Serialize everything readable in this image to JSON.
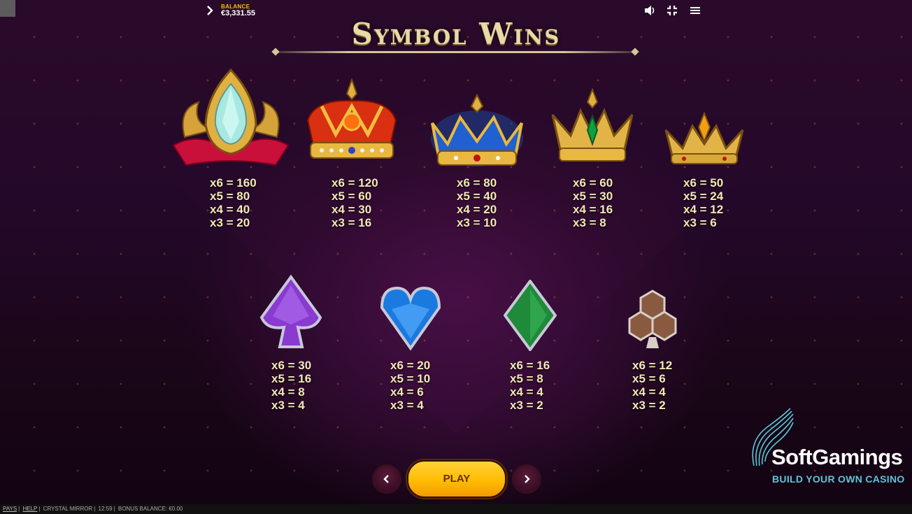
{
  "top_bar": {
    "balance_label": "BALANCE",
    "balance_value": "€3,331.55",
    "icons": [
      "chevron-right-icon",
      "sound-icon",
      "fullscreen-exit-icon",
      "menu-icon"
    ]
  },
  "title": "Symbol Wins",
  "high_symbols": [
    {
      "icon": "jeweled-tiara-icon",
      "pays": [
        "x6 = 160",
        "x5 = 80",
        "x4 = 40",
        "x3 = 20"
      ]
    },
    {
      "icon": "red-crown-icon",
      "pays": [
        "x6 = 120",
        "x5 = 60",
        "x4 = 30",
        "x3 = 16"
      ]
    },
    {
      "icon": "blue-crown-icon",
      "pays": [
        "x6 = 80",
        "x5 = 40",
        "x4 = 20",
        "x3 = 10"
      ]
    },
    {
      "icon": "green-gem-crown-icon",
      "pays": [
        "x6 = 60",
        "x5 = 30",
        "x4 = 16",
        "x3 = 8"
      ]
    },
    {
      "icon": "small-gold-crown-icon",
      "pays": [
        "x6 = 50",
        "x5 = 24",
        "x4 = 12",
        "x3 = 6"
      ]
    }
  ],
  "low_symbols": [
    {
      "icon": "purple-spade-icon",
      "pays": [
        "x6 = 30",
        "x5 = 16",
        "x4 = 8",
        "x3 = 4"
      ]
    },
    {
      "icon": "blue-heart-icon",
      "pays": [
        "x6 = 20",
        "x5 = 10",
        "x4 = 6",
        "x3 = 4"
      ]
    },
    {
      "icon": "green-diamond-icon",
      "pays": [
        "x6 = 16",
        "x5 = 8",
        "x4 = 4",
        "x3 = 2"
      ]
    },
    {
      "icon": "brown-club-icon",
      "pays": [
        "x6 = 12",
        "x5 = 6",
        "x4 = 4",
        "x3 = 2"
      ]
    }
  ],
  "navigation": {
    "prev_icon": "chevron-left-icon",
    "play_label": "PLAY",
    "next_icon": "chevron-right-icon"
  },
  "branding": {
    "name": "SoftGamings",
    "tagline": "BUILD YOUR OWN CASINO"
  },
  "footer": {
    "pays_link": "PAYS",
    "help_link": "HELP",
    "game_name": "CRYSTAL MIRROR",
    "time": "12:59",
    "bonus_balance": "BONUS BALANCE: €0.00"
  },
  "colors": {
    "accent_gold": "#f3c400",
    "pay_text": "#f4e8b8",
    "brand_teal": "#5cc6d8",
    "background": "#24082a"
  }
}
